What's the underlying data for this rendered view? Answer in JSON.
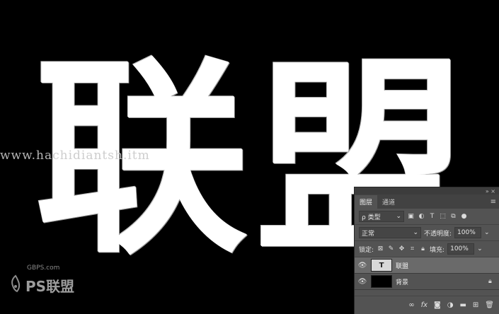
{
  "canvas": {
    "main_text": "联盟",
    "watermark": "www.hachidiantsh.itm",
    "logo_site": "GBPS.com",
    "logo_brand": "PS联盟"
  },
  "layers_panel": {
    "tabs": [
      "图层",
      "通道"
    ],
    "filter_label": "ρ 类型",
    "blend_mode": "正常",
    "opacity_label": "不透明度:",
    "opacity_value": "100%",
    "lock_label": "锁定:",
    "fill_label": "填充:",
    "fill_value": "100%",
    "layers": [
      {
        "name": "联盟",
        "type": "text",
        "selected": true,
        "thumb_glyph": "T"
      },
      {
        "name": "背景",
        "type": "background",
        "selected": false
      }
    ],
    "bottom_icons": [
      "link-icon",
      "fx-icon",
      "mask-icon",
      "adjustment-icon",
      "folder-icon",
      "new-layer-icon",
      "trash-icon"
    ],
    "bottom_labels": {
      "link": "∞",
      "fx": "fx"
    }
  }
}
